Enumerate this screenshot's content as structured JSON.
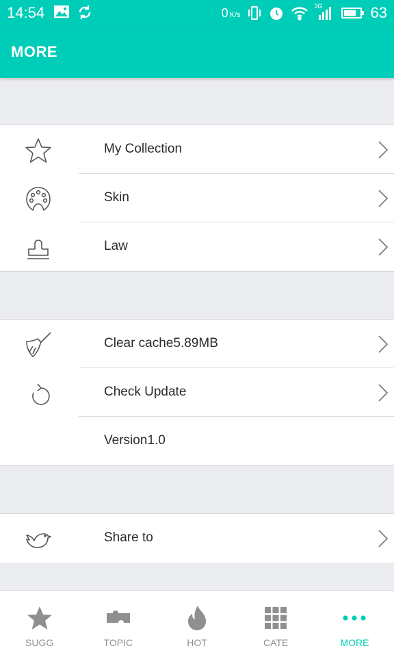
{
  "status_bar": {
    "time": "14:54",
    "net_speed": "0",
    "net_unit": "K/s",
    "network_type": "3G",
    "battery": "63",
    "icons": [
      "image-icon",
      "sync-icon",
      "vibrate-icon",
      "alarm-icon",
      "wifi-icon",
      "signal-icon",
      "battery-icon"
    ]
  },
  "app_bar": {
    "title": "MORE"
  },
  "groups": [
    {
      "items": [
        {
          "icon": "star-icon",
          "label": "My Collection",
          "has_arrow": true
        },
        {
          "icon": "palette-icon",
          "label": "Skin",
          "has_arrow": true
        },
        {
          "icon": "stamp-icon",
          "label": "Law",
          "has_arrow": true
        }
      ]
    },
    {
      "items": [
        {
          "icon": "broom-icon",
          "label": "Clear cache5.89MB",
          "has_arrow": true
        },
        {
          "icon": "refresh-icon",
          "label": "Check Update",
          "has_arrow": true
        },
        {
          "icon": "",
          "label": "Version1.0",
          "has_arrow": false
        }
      ]
    },
    {
      "items": [
        {
          "icon": "bird-icon",
          "label": "Share to",
          "has_arrow": true
        }
      ]
    }
  ],
  "tabs": [
    {
      "icon": "star-filled-icon",
      "label": "SUGG",
      "active": false
    },
    {
      "icon": "puzzle-icon",
      "label": "TOPIC",
      "active": false
    },
    {
      "icon": "flame-icon",
      "label": "HOT",
      "active": false
    },
    {
      "icon": "grid-icon",
      "label": "CATE",
      "active": false
    },
    {
      "icon": "dots-icon",
      "label": "MORE",
      "active": true
    }
  ],
  "colors": {
    "accent": "#00cdb8",
    "background": "#ecedf0",
    "inactive_tab": "#8f8f8f",
    "text": "#2b2b2b"
  }
}
